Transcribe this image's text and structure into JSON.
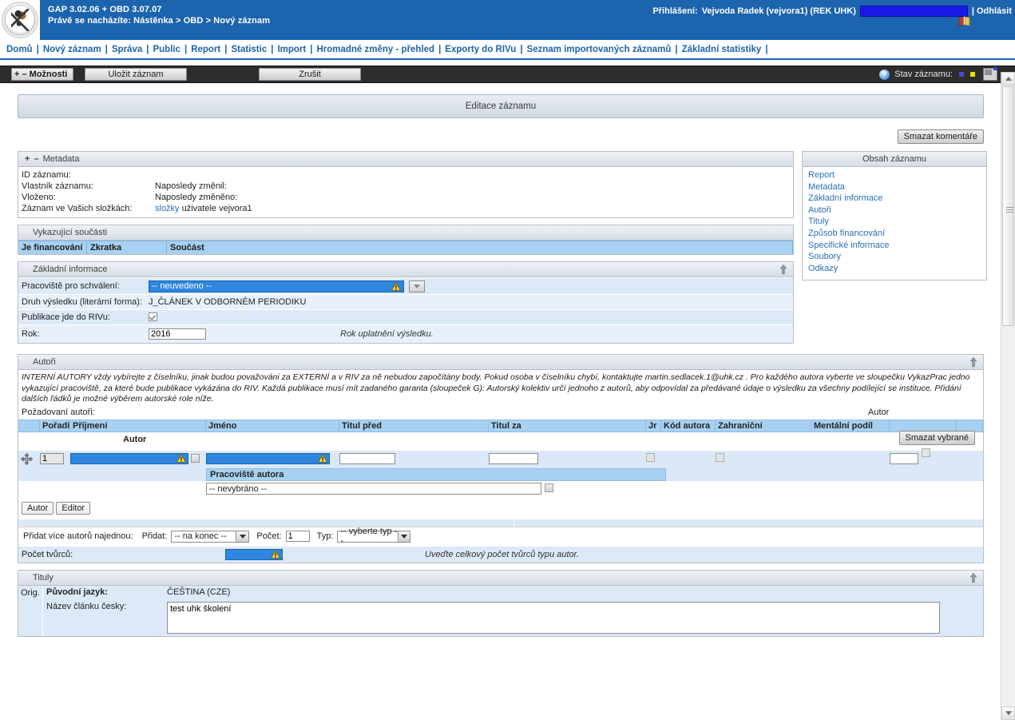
{
  "header": {
    "app_title": "GAP 3.02.06 + OBD 3.07.07",
    "breadcrumb": "Právě se nacházíte: Nástěnka  >   OBD  > Nový záznam",
    "login_label": "Přihlášení:",
    "login_user": "Vejvoda Radek (vejvora1) (REK UHK)",
    "logout_label": "| Odhlásit"
  },
  "nav": {
    "items": [
      "Domů",
      "Nový záznam",
      "Správa",
      "Public",
      "Report",
      "Statistic",
      "Import",
      "Hromadné změny - přehled",
      "Exporty do RIVu",
      "Seznam importovaných záznamů",
      "Základní statistiky"
    ],
    "separator": "|"
  },
  "toolbar": {
    "options_label": "+ – Možnosti",
    "save_label": "Uložit záznam",
    "cancel_label": "Zrušit",
    "help_glyph": "?",
    "status_label": "Stav záznamu:"
  },
  "page": {
    "title": "Editace záznamu",
    "delete_comments_label": "Smazat komentáře"
  },
  "metadata": {
    "panel_title": "Metadata",
    "toggle": "+ –",
    "rows": [
      {
        "label": "ID záznamu:",
        "label2": "",
        "value": ""
      },
      {
        "label": "Vlastník záznamu:",
        "label2": "Naposledy změnil:",
        "value": ""
      },
      {
        "label": "Vloženo:",
        "label2": "Naposledy změněno:",
        "value": ""
      },
      {
        "label": "Záznam ve Vašich složkách:",
        "label2": "",
        "value": ""
      }
    ],
    "folders_link": "složky",
    "folders_rest": " uživatele vejvora1"
  },
  "toc": {
    "title": "Obsah záznamu",
    "items": [
      "Report",
      "Metadata",
      "Základní informace",
      "Autoři",
      "Tituly",
      "Způsob financování",
      "Specifické informace",
      "Soubory",
      "Odkazy"
    ]
  },
  "vykazujici": {
    "panel_title": "Vykazující součásti",
    "columns": [
      "Je financování",
      "Zkratka",
      "Součást"
    ]
  },
  "zakladni": {
    "panel_title": "Základní informace",
    "pracoviste_label": "Pracoviště pro schválení:",
    "pracoviste_value": "-- neuvedeno --",
    "druh_label": "Druh výsledku (literární forma):",
    "druh_value": "J_ČLÁNEK V ODBORNÉM PERIODIKU",
    "riv_label": "Publikace jde do RIVu:",
    "rok_label": "Rok:",
    "rok_value": "2016",
    "rok_hint": "Rok uplatnění výsledku."
  },
  "autori": {
    "panel_title": "Autoři",
    "note": "INTERNÍ AUTORY vždy vybírejte z číselníku, jinak budou považováni za EXTERNÍ a v RIV za ně nebudou započítány body. Pokud osoba v číselníku chybí, kontaktujte martin.sedlacek.1@uhk.cz . Pro každého autora vyberte ve sloupečku VykazPrac jedno vykazující pracoviště, za které bude publikace vykázána do RIV. Každá publikace musí mít zadaného garanta (sloupeček G): Autorský kolektiv určí jednoho z autorů, aby odpovídal za předávané údaje o výsledku za všechny podílející se instituce. Přidání dalších řádků je možné výběrem autorské role níže.",
    "required_label": "Požadovaní autoři:",
    "autor_col_label": "Autor",
    "columns": [
      "",
      "Pořadí",
      "Příjmení",
      "Jméno",
      "Titul před",
      "Titul za",
      "Jr",
      "Kód autora",
      "Zahraniční",
      "Mentální podíl",
      "",
      ""
    ],
    "role_label": "Autor",
    "delete_selected_label": "Smazat vybrané",
    "row": {
      "poradi": "1",
      "prijmeni": "",
      "jmeno": "",
      "titul_pred": "",
      "titul_za": "",
      "kod_autora": "",
      "mentalni_podil": ""
    },
    "pracoviste_autora_label": "Pracoviště autora",
    "pracoviste_autora_value": "-- nevybráno --",
    "btn_autor": "Autor",
    "btn_editor": "Editor",
    "bulk_label": "Přidat více autorů najednou:",
    "bulk_pridat_label": "Přidat:",
    "bulk_pridat_value": "-- na konec --",
    "bulk_pocet_label": "Počet:",
    "bulk_pocet_value": "1",
    "bulk_typ_label": "Typ:",
    "bulk_typ_value": "-- vyberte typ --",
    "pocet_tvurcu_label": "Počet tvůrců:",
    "pocet_tvurcu_value": "",
    "pocet_tvurcu_hint": "Uveďte celkový počet tvůrců typu autor."
  },
  "tituly": {
    "panel_title": "Tituly",
    "orig_label": "Orig.",
    "jazyk_label": "Původní jazyk:",
    "jazyk_value": "ČEŠTINA (CZE)",
    "nazev_label": "Název článku česky:",
    "nazev_value": "test uhk školení"
  },
  "colors": {
    "brand_blue": "#1c64ad",
    "link_blue": "#2a6fb5",
    "table_header_blue": "#a8d0f0",
    "field_blue": "#2e86de",
    "row_blue": "#dce9f7"
  }
}
